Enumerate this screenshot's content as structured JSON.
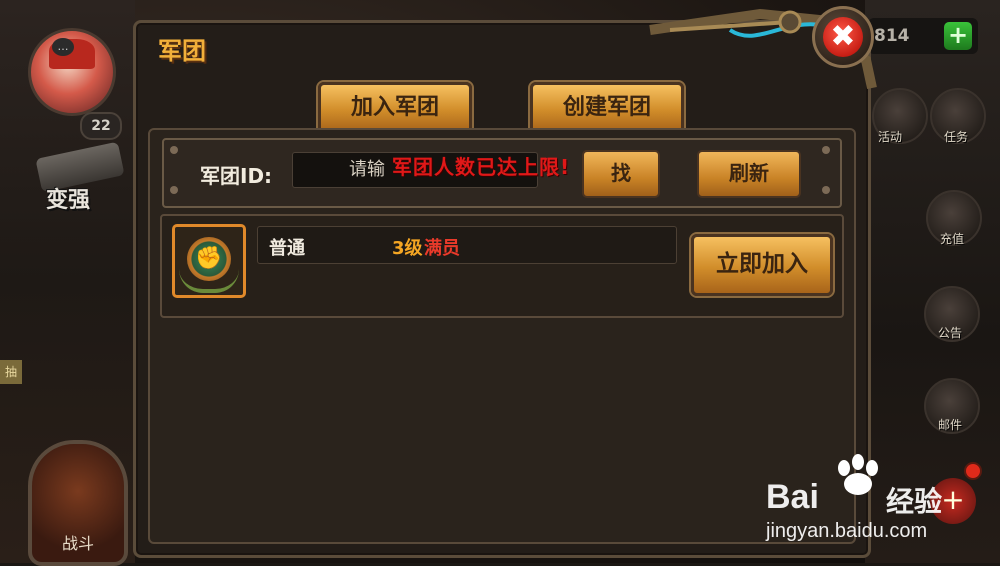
{
  "hud": {
    "avatar_level": "22",
    "chat_icon": "…",
    "strengthen_label": "变强",
    "left_tag": "抽",
    "battle_label": "战斗",
    "gold_amount": "814",
    "gold_plus": "+",
    "right_side": [
      {
        "label": "活动"
      },
      {
        "label": "任务"
      },
      {
        "label": "充值"
      },
      {
        "label": "公告"
      },
      {
        "label": "邮件"
      }
    ]
  },
  "panel": {
    "title": "军团",
    "close_glyph": "✖",
    "tabs": {
      "join": "加入军团",
      "create": "创建军团"
    },
    "search": {
      "id_label": "军团ID:",
      "input_value": "请输",
      "search_button": "找",
      "refresh_button": "刷新"
    },
    "error_text": "军团人数已达上限!",
    "legion": {
      "name": "普通",
      "level": "3级",
      "status": "满员",
      "join_button": "立即加入"
    }
  },
  "watermark": {
    "brand": "Bai",
    "brand_cn": "经验",
    "url": "jingyan.baidu.com"
  },
  "colors": {
    "accent_gold": "#f2b03a",
    "error_red": "#e01818",
    "level_orange": "#f5a623",
    "status_red": "#ea3a2a"
  }
}
